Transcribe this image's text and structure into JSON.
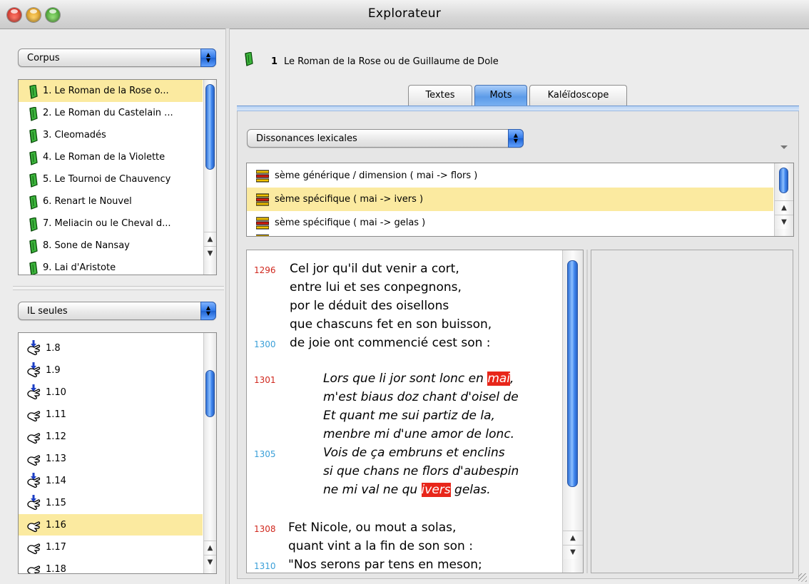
{
  "window": {
    "title": "Explorateur"
  },
  "corpus_popup": {
    "label": "Corpus"
  },
  "corpus_list": [
    "1. Le Roman de la Rose o...",
    "2. Le Roman du Castelain ...",
    "3. Cleomadés",
    "4. Le Roman de la Violette",
    "5. Le Tournoi de Chauvency",
    "6. Renart le Nouvel",
    "7. Meliacin ou le Cheval d...",
    "8. Sone de Nansay",
    "9. Lai d'Aristote"
  ],
  "il_popup": {
    "label": "IL seules"
  },
  "il_list": [
    "1.8",
    "1.9",
    "1.10",
    "1.11",
    "1.12",
    "1.13",
    "1.14",
    "1.15",
    "1.16",
    "1.17",
    "1.18"
  ],
  "header": {
    "number": "1",
    "title": "Le Roman de la Rose ou de Guillaume de Dole"
  },
  "tabs": [
    "Textes",
    "Mots",
    "Kaléïdoscope"
  ],
  "active_tab": "Mots",
  "dissonance_popup": {
    "label": "Dissonances lexicales"
  },
  "relations": [
    "sème générique / dimension ( mai -> flors )",
    "sème spécifique ( mai -> ivers )",
    "sème spécifique ( mai -> gelas )"
  ],
  "text": {
    "l1": {
      "num": "1296",
      "text": "Cel jor qu'il dut venir a cort,"
    },
    "l2": {
      "text": "entre lui et ses conpegnons,"
    },
    "l3": {
      "text": "por le déduit des oisellons"
    },
    "l4": {
      "text": "que chascuns fet en son buisson,"
    },
    "l5": {
      "num": "1300",
      "text": "de joie ont commencié cest son :"
    },
    "l6": {
      "num": "1301",
      "pre": "Lors que li jor sont lonc en ",
      "hl": "mai",
      "post": ","
    },
    "l7": {
      "text": "m'est biaus doz chant d'oisel de"
    },
    "l8": {
      "text": "Et quant me sui partiz de la,"
    },
    "l9": {
      "text": "menbre mi d'une amor de lonc."
    },
    "l10": {
      "num": "1305",
      "text": "Vois de ça embruns et enclins"
    },
    "l11": {
      "text": "si que chans ne flors d'aubespin"
    },
    "l12": {
      "pre": "ne mi val ne qu ",
      "hl": "ivers",
      "post": " gelas."
    },
    "l13": {
      "num": "1308",
      "text": "Fet Nicole, ou mout a solas,"
    },
    "l14": {
      "text": "quant vint a la fin de son son :"
    },
    "l15": {
      "num": "1310",
      "text": "\"Nos serons par tens en meson;"
    }
  },
  "colors": {
    "selection": "#fbeaa0",
    "highlight": "#e8261a",
    "accent_blue": "#3f86ee"
  }
}
